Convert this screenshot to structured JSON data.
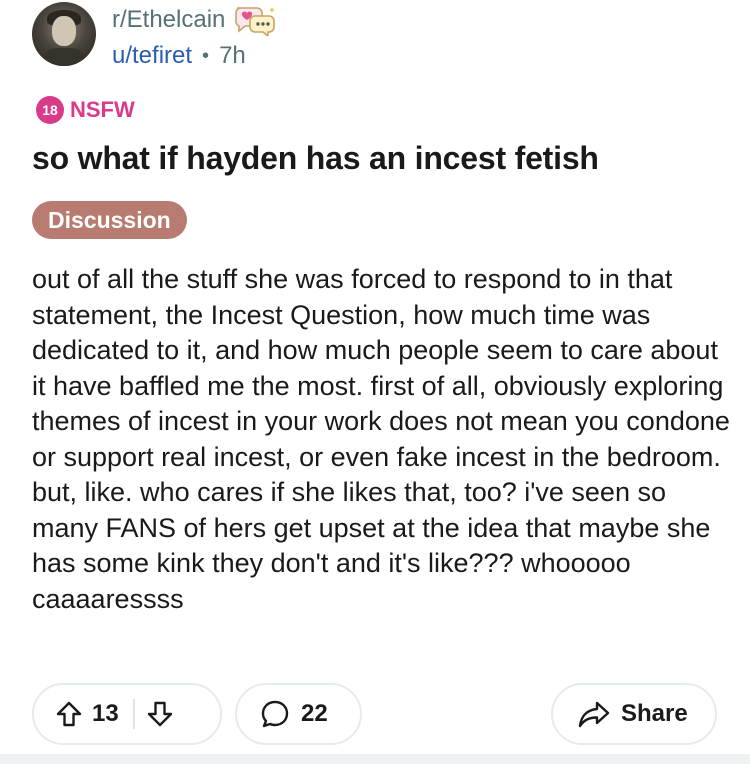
{
  "post": {
    "subreddit": "r/Ethelcain",
    "username": "u/tefiret",
    "separator": "•",
    "time": "7h",
    "nsfw_badge": "18",
    "nsfw_label": "NSFW",
    "title": "so what if hayden has an incest fetish",
    "flair": "Discussion",
    "body": "out of all the stuff she was forced to respond to in that statement, the Incest Question, how much time was dedicated to it, and how much people seem to care about it have baffled me the most. first of all, obviously exploring themes of incest in your work does not mean you condone or support real incest, or even fake incest in the bedroom. but, like. who cares if she likes that, too? i've seen so many FANS of hers get upset at the idea that maybe she has some kink they don't and it's like??? whooooo caaaaressss"
  },
  "actions": {
    "upvote_count": "13",
    "comment_count": "22",
    "share_label": "Share"
  },
  "colors": {
    "nsfw": "#d93a8a",
    "flair_bg": "#b77b71",
    "username": "#2a5db0",
    "muted": "#576f76"
  },
  "icons": {
    "upvote": "arrow-up-icon",
    "downvote": "arrow-down-icon",
    "comment": "comment-bubble-icon",
    "share": "share-arrow-icon",
    "subreddit_badge": "chat-hearts-icon"
  }
}
